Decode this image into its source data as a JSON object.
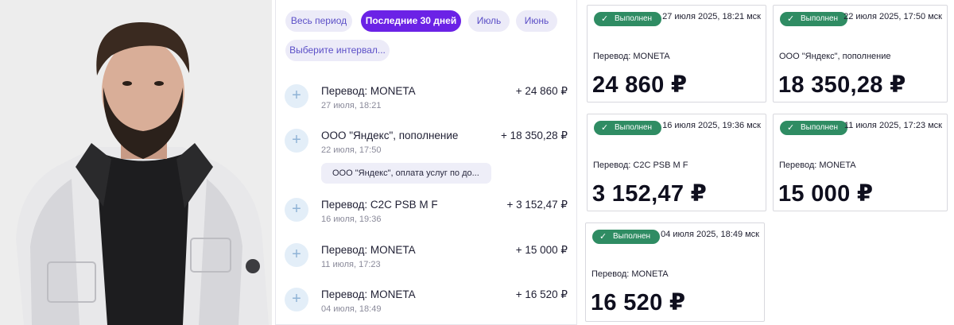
{
  "filters": [
    {
      "label": "Весь период",
      "active": false
    },
    {
      "label": "Последние 30 дней",
      "active": true
    },
    {
      "label": "Июль",
      "active": false
    },
    {
      "label": "Июнь",
      "active": false
    },
    {
      "label": "Выберите интервал...",
      "active": false
    }
  ],
  "transactions": [
    {
      "title": "Перевод: MONETA",
      "date": "27 июля, 18:21",
      "amount": "+ 24 860 ₽"
    },
    {
      "title": "ООО \"Яндекс\", пополнение",
      "date": "22 июля, 17:50",
      "amount": "+ 18 350,28 ₽"
    },
    {
      "title": "Перевод: C2C PSB M F",
      "date": "16 июля, 19:36",
      "amount": "+ 3 152,47 ₽"
    },
    {
      "title": "Перевод: MONETA",
      "date": "11 июля, 17:23",
      "amount": "+ 15 000 ₽"
    },
    {
      "title": "Перевод: MONETA",
      "date": "04 июля, 18:49",
      "amount": "+ 16 520 ₽"
    }
  ],
  "transaction_note": "ООО \"Яндекс\", оплата услуг по до...",
  "receipts": [
    {
      "status": "Выполнен",
      "datetime": "27 июля 2025, 18:21 мск",
      "description": "Перевод: MONETA",
      "sum": "24 860 ₽"
    },
    {
      "status": "Выполнен",
      "datetime": "22 июля 2025, 17:50 мск",
      "description": "ООО \"Яндекс\", пополнение",
      "sum": "18 350,28 ₽"
    },
    {
      "status": "Выполнен",
      "datetime": "16 июля 2025, 19:36 мск",
      "description": "Перевод: C2C PSB M F",
      "sum": "3 152,47 ₽"
    },
    {
      "status": "Выполнен",
      "datetime": "11 июля 2025, 17:23 мск",
      "description": "Перевод: MONETA",
      "sum": "15 000 ₽"
    },
    {
      "status": "Выполнен",
      "datetime": "04 июля 2025, 18:49 мск",
      "description": "Перевод: MONETA",
      "sum": "16 520 ₽"
    }
  ],
  "icons": {
    "add": "plus-icon",
    "status": "checkmark-icon"
  },
  "colors": {
    "accent": "#6b22e6",
    "chip_bg": "#ecebf8",
    "chip_text": "#5b4fc7",
    "status_green": "#2f8c63"
  }
}
